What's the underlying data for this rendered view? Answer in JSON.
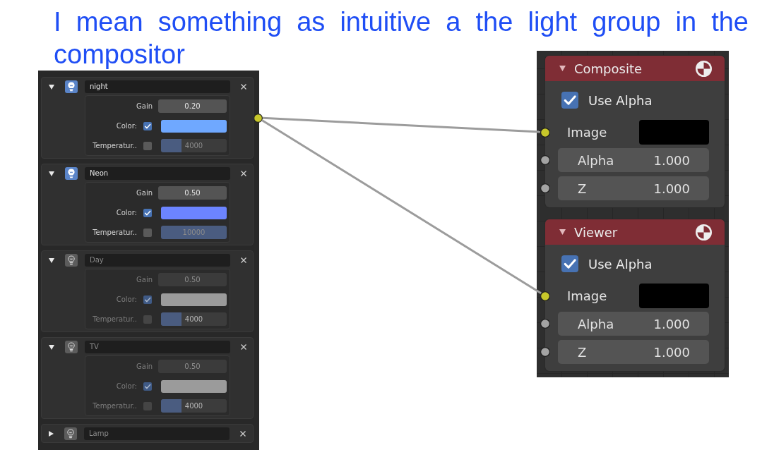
{
  "caption_lines": [
    "I mean something as intuitive a the light group in the",
    "compositor"
  ],
  "light_groups": [
    {
      "name": "night",
      "expanded": true,
      "enabled": true,
      "output_linked": true,
      "gain_label": "Gain",
      "gain": "0.20",
      "color_label": "Color:",
      "color_checked": true,
      "color": "#6fa8ff",
      "temperature_label": "Temperatur..",
      "temperature_checked": false,
      "temperature": "4000",
      "level": 0.31
    },
    {
      "name": "Neon",
      "expanded": true,
      "enabled": true,
      "output_linked": false,
      "gain_label": "Gain",
      "gain": "0.50",
      "color_label": "Color:",
      "color_checked": true,
      "color": "#6c84ff",
      "temperature_label": "Temperatur..",
      "temperature_checked": false,
      "temperature": "10000",
      "level": 1.0
    },
    {
      "name": "Day",
      "expanded": true,
      "enabled": false,
      "output_linked": false,
      "gain_label": "Gain",
      "gain": "0.50",
      "color_label": "Color:",
      "color_checked": true,
      "color": "#9b9b9b",
      "temperature_label": "Temperatur..",
      "temperature_checked": false,
      "temperature": "4000",
      "level": 0.31
    },
    {
      "name": "TV",
      "expanded": true,
      "enabled": false,
      "output_linked": false,
      "gain_label": "Gain",
      "gain": "0.50",
      "color_label": "Color:",
      "color_checked": true,
      "color": "#9b9b9b",
      "temperature_label": "Temperatur..",
      "temperature_checked": false,
      "temperature": "4000",
      "level": 0.31
    },
    {
      "name": "Lamp",
      "expanded": false,
      "enabled": false,
      "output_linked": false
    }
  ],
  "nodes": [
    {
      "title": "Composite",
      "expanded": true,
      "use_alpha_label": "Use Alpha",
      "use_alpha": true,
      "inputs": [
        {
          "kind": "image",
          "label": "Image",
          "linked": true
        },
        {
          "kind": "value",
          "label": "Alpha",
          "value": "1.000",
          "linked": false
        },
        {
          "kind": "value",
          "label": "Z",
          "value": "1.000",
          "linked": false
        }
      ]
    },
    {
      "title": "Viewer",
      "expanded": true,
      "use_alpha_label": "Use Alpha",
      "use_alpha": true,
      "inputs": [
        {
          "kind": "image",
          "label": "Image",
          "linked": true
        },
        {
          "kind": "value",
          "label": "Alpha",
          "value": "1.000",
          "linked": false
        },
        {
          "kind": "value",
          "label": "Z",
          "value": "1.000",
          "linked": false
        }
      ]
    }
  ]
}
